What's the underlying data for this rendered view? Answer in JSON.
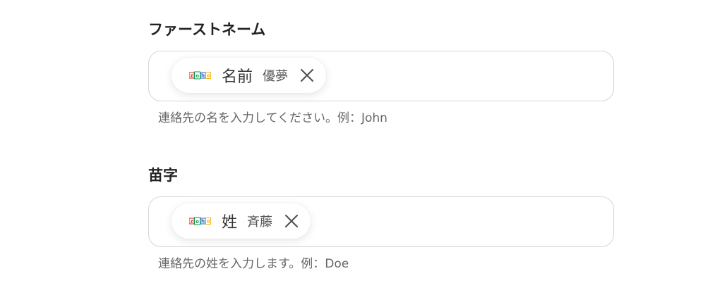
{
  "fields": [
    {
      "label": "ファーストネーム",
      "chip": {
        "app_icon": "zoho-logo-icon",
        "main": "名前",
        "sub": "優夢"
      },
      "help": "連絡先の名を入力してください。例：John"
    },
    {
      "label": "苗字",
      "chip": {
        "app_icon": "zoho-logo-icon",
        "main": "姓",
        "sub": "斉藤"
      },
      "help": "連絡先の姓を入力します。例：Doe"
    }
  ],
  "colors": {
    "zoho_z": "#e42527",
    "zoho_o1": "#089949",
    "zoho_h": "#226db4",
    "zoho_o2": "#f9b21d"
  }
}
